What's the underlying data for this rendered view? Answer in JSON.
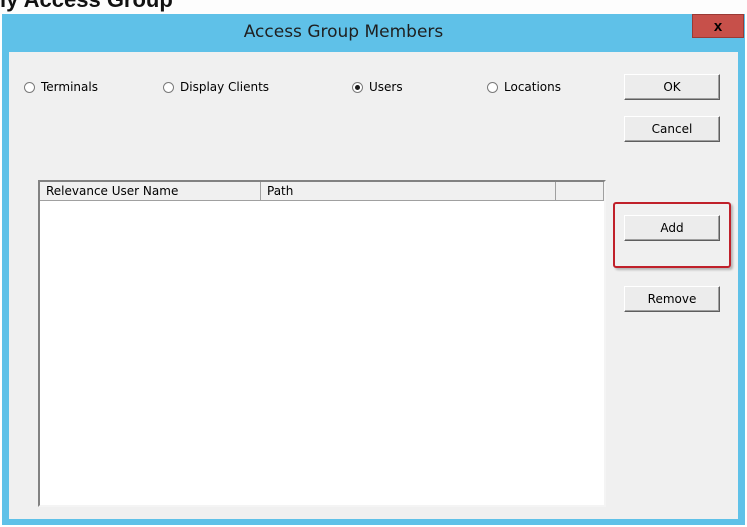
{
  "top_caption": "ly Access Group",
  "window": {
    "title": "Access Group Members",
    "close_glyph": "x"
  },
  "radio_group": [
    {
      "label": "Terminals",
      "checked": false
    },
    {
      "label": "Display Clients",
      "checked": false
    },
    {
      "label": "Users",
      "checked": true
    },
    {
      "label": "Locations",
      "checked": false
    }
  ],
  "buttons": {
    "ok": "OK",
    "cancel": "Cancel",
    "add": "Add",
    "remove": "Remove"
  },
  "list": {
    "columns": [
      "Relevance User Name",
      "Path",
      ""
    ],
    "rows": []
  },
  "colors": {
    "title_bar": "#5fc1e8",
    "close_button": "#c7504a",
    "highlight": "#c0202a",
    "dialog_face": "#f0f0f0"
  }
}
